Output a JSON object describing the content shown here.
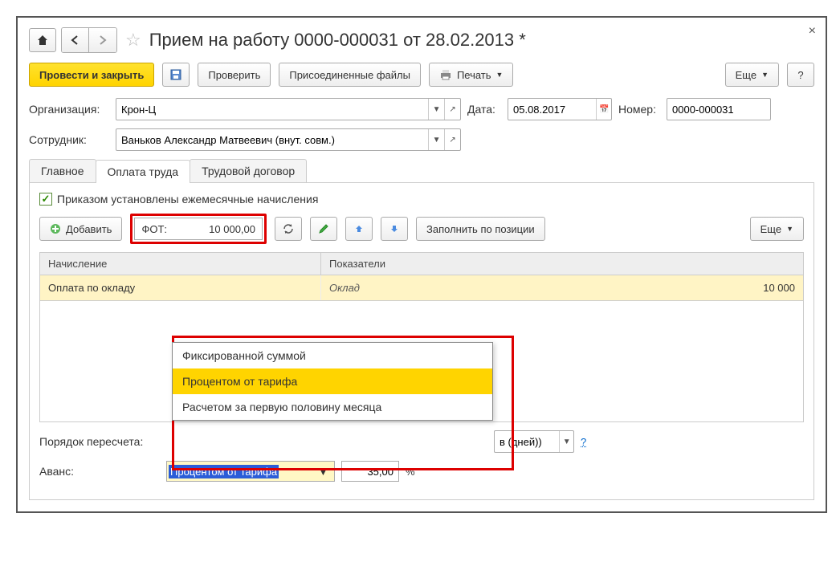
{
  "header": {
    "title": "Прием на работу 0000-000031 от 28.02.2013 *"
  },
  "toolbar": {
    "post_close": "Провести и закрыть",
    "verify": "Проверить",
    "attachments": "Присоединенные файлы",
    "print": "Печать",
    "more": "Еще",
    "help": "?"
  },
  "form": {
    "org_label": "Организация:",
    "org_value": "Крон-Ц",
    "date_label": "Дата:",
    "date_value": "05.08.2017",
    "number_label": "Номер:",
    "number_value": "0000-000031",
    "employee_label": "Сотрудник:",
    "employee_value": "Ваньков Александр Матвеевич (внут. совм.)"
  },
  "tabs": {
    "main": "Главное",
    "pay": "Оплата труда",
    "contract": "Трудовой договор"
  },
  "panel": {
    "chk_label": "Приказом установлены ежемесячные начисления",
    "add": "Добавить",
    "fot_label": "ФОТ:",
    "fot_value": "10 000,00",
    "fill_by_position": "Заполнить по позиции",
    "more": "Еще"
  },
  "table": {
    "col1": "Начисление",
    "col2": "Показатели",
    "row1": {
      "name": "Оплата по окладу",
      "indicator": "Оклад",
      "value": "10 000"
    }
  },
  "bottom": {
    "recalc_label": "Порядок пересчета:",
    "recalc_tail": "в (дней))",
    "advance_label": "Аванс:",
    "advance_value": "Процентом от тарифа",
    "advance_pct": "35,00",
    "advance_unit": "%"
  },
  "dropdown": {
    "opt1": "Фиксированной суммой",
    "opt2": "Процентом от тарифа",
    "opt3": "Расчетом за первую половину месяца"
  }
}
